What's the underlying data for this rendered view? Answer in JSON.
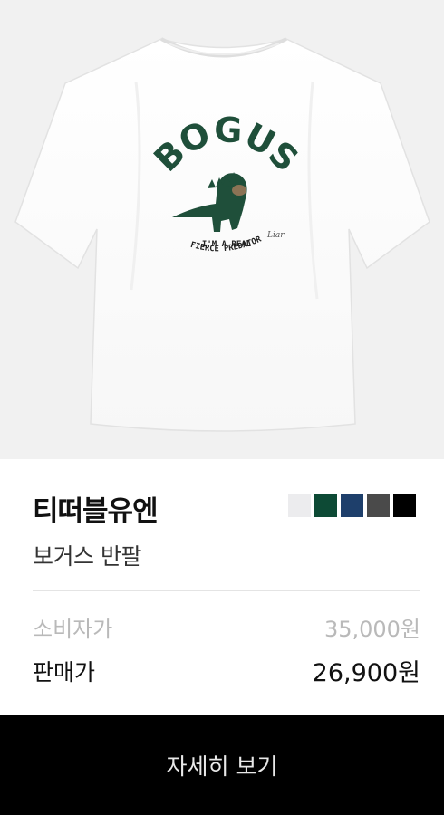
{
  "product": {
    "image_print": {
      "title": "BOGUS",
      "line1": "I'M A REAL",
      "line2": "FIERCE PREDATOR",
      "signature": "Liar"
    },
    "brand": "티떠블유엔",
    "name": "보거스 반팔",
    "colors": [
      "#ececee",
      "#0d4a35",
      "#1e3f6b",
      "#4a4a4a",
      "#000000"
    ],
    "prices": {
      "msrp_label": "소비자가",
      "msrp_value": "35,000원",
      "sale_label": "판매가",
      "sale_value": "26,900원"
    }
  },
  "cta": {
    "label": "자세히 보기"
  }
}
